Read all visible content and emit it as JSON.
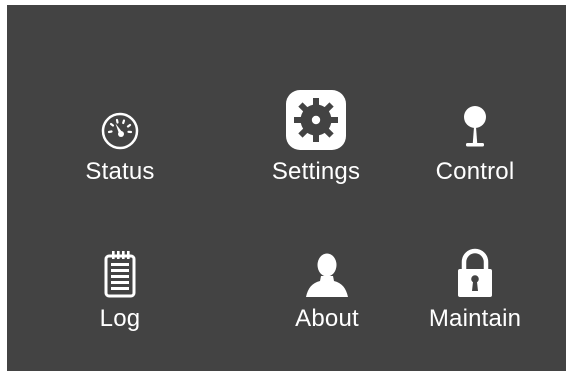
{
  "menu": {
    "items": [
      {
        "label": "Status",
        "icon": "speedometer-icon"
      },
      {
        "label": "Settings",
        "icon": "gear-icon",
        "selected": true
      },
      {
        "label": "Control",
        "icon": "joystick-icon"
      },
      {
        "label": "Log",
        "icon": "notepad-icon"
      },
      {
        "label": "About",
        "icon": "person-icon"
      },
      {
        "label": "Maintain",
        "icon": "padlock-icon"
      }
    ]
  },
  "colors": {
    "background": "#434343",
    "foreground": "#ffffff"
  }
}
